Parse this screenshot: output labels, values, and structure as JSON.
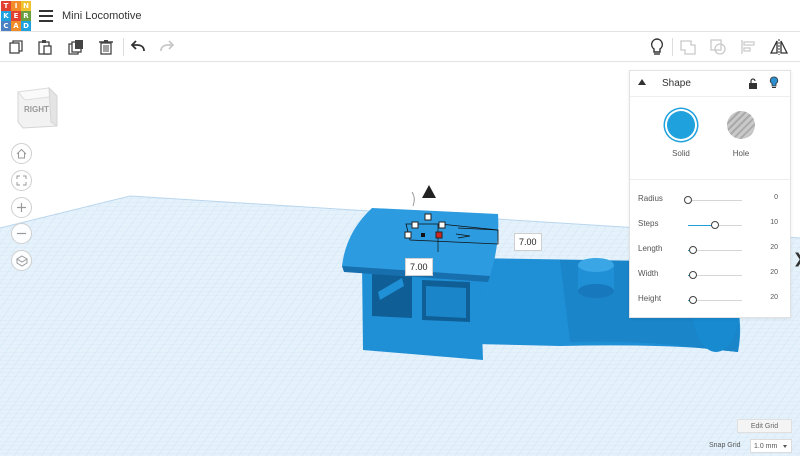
{
  "app": {
    "logo_letters": [
      "T",
      "I",
      "N",
      "K",
      "E",
      "R",
      "C",
      "A",
      "D"
    ],
    "logo_colors": [
      "#e3412f",
      "#f28c28",
      "#f2c12e",
      "#1ea1dc",
      "#e3412f",
      "#6a9e3f",
      "#4a7fc1",
      "#f28c28",
      "#1ea1dc"
    ],
    "document_title": "Mini Locomotive"
  },
  "toolbar": {
    "left_icons": [
      "copy-icon",
      "paste-icon",
      "duplicate-icon",
      "delete-icon",
      "undo-icon",
      "redo-icon"
    ],
    "right_icons": [
      "lightbulb-icon",
      "group-icon",
      "ungroup-icon",
      "align-icon",
      "mirror-icon"
    ]
  },
  "viewcube": {
    "face_label": "RIGHT"
  },
  "nav_controls": [
    "home-icon",
    "fit-view-icon",
    "zoom-in-icon",
    "zoom-out-icon",
    "perspective-icon"
  ],
  "dimensions": {
    "length_label": "7.00",
    "width_label": "7.00"
  },
  "shape_panel": {
    "title": "Shape",
    "types": [
      {
        "label": "Solid",
        "color": "#1ea1dc",
        "selected": true
      },
      {
        "label": "Hole",
        "color": "#b9b9b9",
        "selected": false
      }
    ],
    "properties": [
      {
        "label": "Radius",
        "value": "0",
        "fraction": 0.0
      },
      {
        "label": "Steps",
        "value": "10",
        "fraction": 0.5
      },
      {
        "label": "Length",
        "value": "20",
        "fraction": 0.1
      },
      {
        "label": "Width",
        "value": "20",
        "fraction": 0.1
      },
      {
        "label": "Height",
        "value": "20",
        "fraction": 0.1
      }
    ]
  },
  "grid": {
    "edit_label": "Edit Grid",
    "snap_label": "Snap Grid",
    "snap_value": "1.0 mm"
  },
  "colors": {
    "model_blue": "#1f8fd6",
    "model_dark": "#1672b0",
    "grid_blue": "#d3e9f7",
    "accent": "#1ea1dc"
  }
}
